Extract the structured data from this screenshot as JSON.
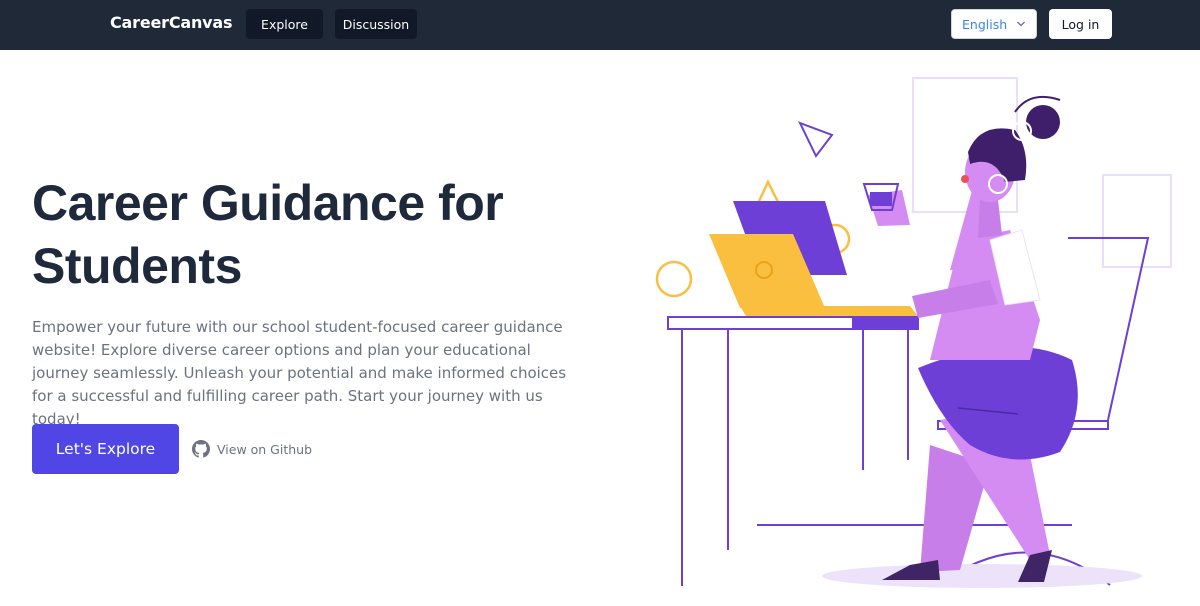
{
  "navbar": {
    "brand": "CareerCanvas",
    "links": [
      {
        "label": "Explore"
      },
      {
        "label": "Discussion"
      }
    ],
    "language": {
      "selected": "English",
      "icon": "chevron-down-icon"
    },
    "login_label": "Log in"
  },
  "hero": {
    "title_line1": "Career Guidance for",
    "title_line2": "Students",
    "description": "Empower your future with our school student-focused career guidance website! Explore diverse career options and plan your educational journey seamlessly. Unleash your potential and make informed choices for a successful and fulfilling career path. Start your journey with us today!",
    "cta_label": "Let's Explore",
    "github_label": "View on Github",
    "github_icon": "github-icon"
  },
  "colors": {
    "navbar_bg": "#1f2937",
    "primary": "#4f46e5",
    "illustration_purple": "#6d3fd6",
    "illustration_pink": "#d48cf2",
    "illustration_yellow": "#fbbf3f"
  }
}
